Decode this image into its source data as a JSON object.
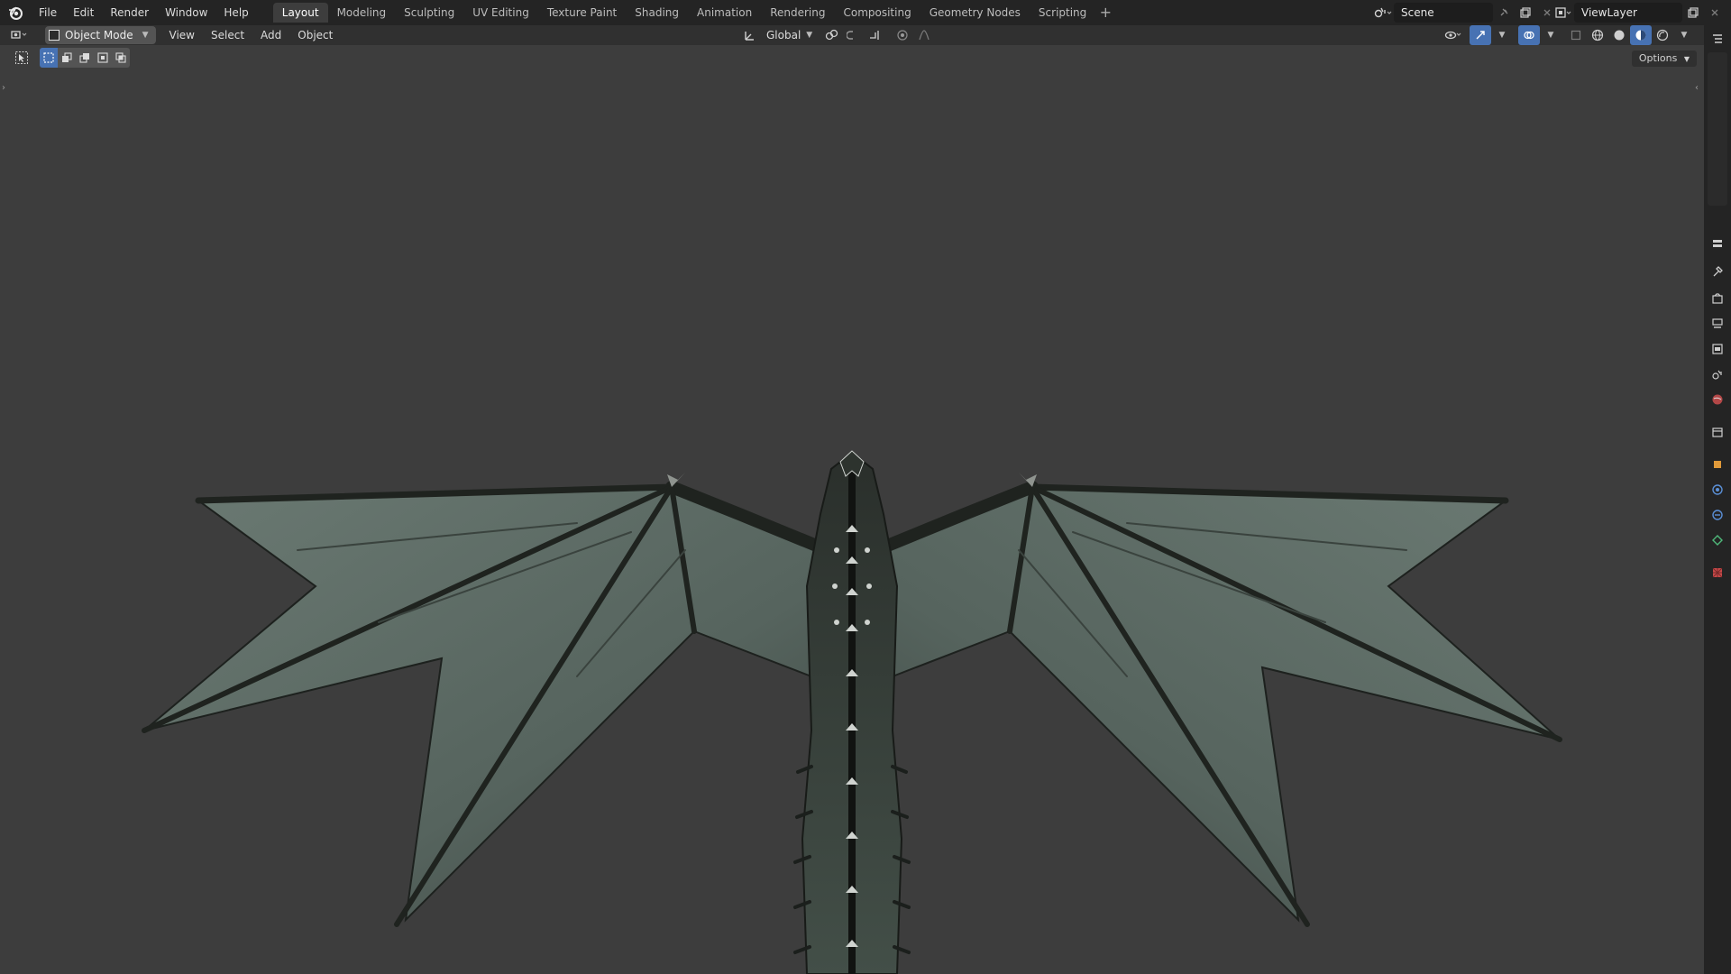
{
  "menu": {
    "file": "File",
    "edit": "Edit",
    "render": "Render",
    "window": "Window",
    "help": "Help"
  },
  "workspace_tabs": [
    {
      "label": "Layout",
      "active": true
    },
    {
      "label": "Modeling"
    },
    {
      "label": "Sculpting"
    },
    {
      "label": "UV Editing"
    },
    {
      "label": "Texture Paint"
    },
    {
      "label": "Shading"
    },
    {
      "label": "Animation"
    },
    {
      "label": "Rendering"
    },
    {
      "label": "Compositing"
    },
    {
      "label": "Geometry Nodes"
    },
    {
      "label": "Scripting"
    }
  ],
  "workspace_add": "+",
  "scene": {
    "name": "Scene"
  },
  "view_layer": {
    "name": "ViewLayer"
  },
  "viewport_header": {
    "mode": "Object Mode",
    "view": "View",
    "select": "Select",
    "add": "Add",
    "object": "Object",
    "orientation": "Global"
  },
  "toolbar": {
    "options": "Options"
  },
  "colors": {
    "topbar": "#242424",
    "viewport_bg": "#3d3d3d",
    "accent_blue": "#4772b3",
    "wing_membrane": "#5f6e68",
    "dragon_dark": "#1f231f"
  },
  "icons": {
    "blender_logo": "blender-logo-icon",
    "scene_browse": "scene-icon",
    "view_layer_browse": "view-layer-icon"
  }
}
